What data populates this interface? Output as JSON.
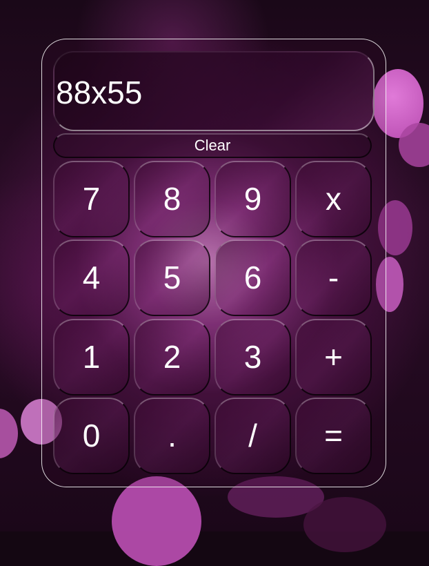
{
  "display": {
    "value": "88x55"
  },
  "clear_label": "Clear",
  "keys": [
    [
      "7",
      "8",
      "9",
      "x"
    ],
    [
      "4",
      "5",
      "6",
      "-"
    ],
    [
      "1",
      "2",
      "3",
      "+"
    ],
    [
      "0",
      ".",
      "/",
      "="
    ]
  ],
  "colors": {
    "background": "#140712",
    "glow": "#d68ccc",
    "bokeh": "#c55fc0",
    "text": "#ffffff"
  }
}
